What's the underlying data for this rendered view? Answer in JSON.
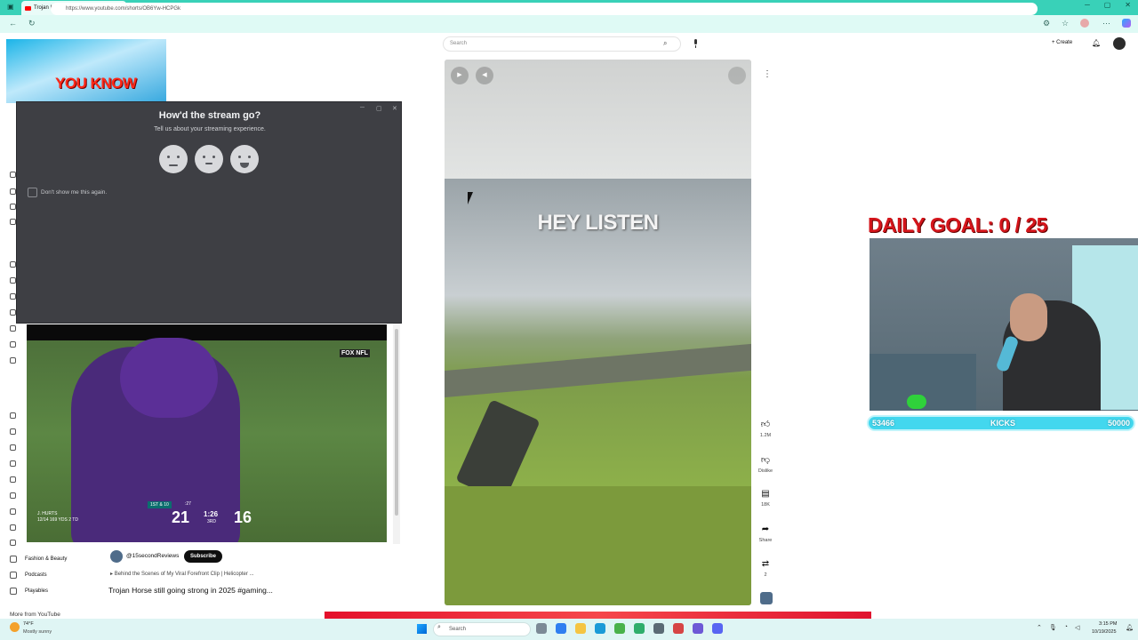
{
  "browser": {
    "tab_title": "Trojan Horse still going strong in 2",
    "tab_close": "✕",
    "new_tab": "+",
    "url": "https://www.youtube.com/shorts/OB6Yw-HCPGk",
    "window_controls": [
      "─",
      "▢",
      "✕"
    ]
  },
  "youtube_header": {
    "search_placeholder": "Search",
    "create_label": "Create"
  },
  "left_overlay": {
    "youknow_text": "YOU KNOW"
  },
  "dialog": {
    "title": "How'd the stream go?",
    "subtitle": "Tell us about your streaming experience.",
    "checkbox_label": "Don't show me this again.",
    "window_controls": [
      "─",
      "▢",
      "✕"
    ]
  },
  "sidebar": {
    "items": [
      {
        "label": "Fashion & Beauty",
        "icon": "hanger-icon"
      },
      {
        "label": "Podcasts",
        "icon": "podcast-icon"
      },
      {
        "label": "Playables",
        "icon": "grid-icon"
      }
    ],
    "more_from": "More from YouTube"
  },
  "football": {
    "network": "FOX NFL",
    "down_distance": "1ST & 10",
    "player_name": "J. HURTS",
    "player_stats": "12/14  169 YDS  2 TD",
    "away_score": "21",
    "clock": "1:26",
    "quarter": "3RD",
    "play_clock": ":27",
    "home_score": "16"
  },
  "channel": {
    "handle": "@15secondReviews",
    "subscribe_label": "Subscribe",
    "related": "Behind the Scenes of My Viral Forefront Clip | Helicopter ...",
    "title": "Trojan Horse still going strong in 2025 #gaming..."
  },
  "player": {
    "caption": "HEY LISTEN"
  },
  "actions": {
    "like_count": "1.2M",
    "dislike_label": "Dislike",
    "comment_count": "18K",
    "share_label": "Share",
    "remix_count": "2"
  },
  "stream_overlay": {
    "goal_text": "DAILY GOAL: 0 / 25",
    "bar_left": "53466",
    "bar_center": "KICKS",
    "bar_right": "50000"
  },
  "taskbar": {
    "temperature": "74°F",
    "weather": "Mostly sunny",
    "search_placeholder": "Search",
    "time": "3:15 PM",
    "date": "10/19/2025"
  }
}
